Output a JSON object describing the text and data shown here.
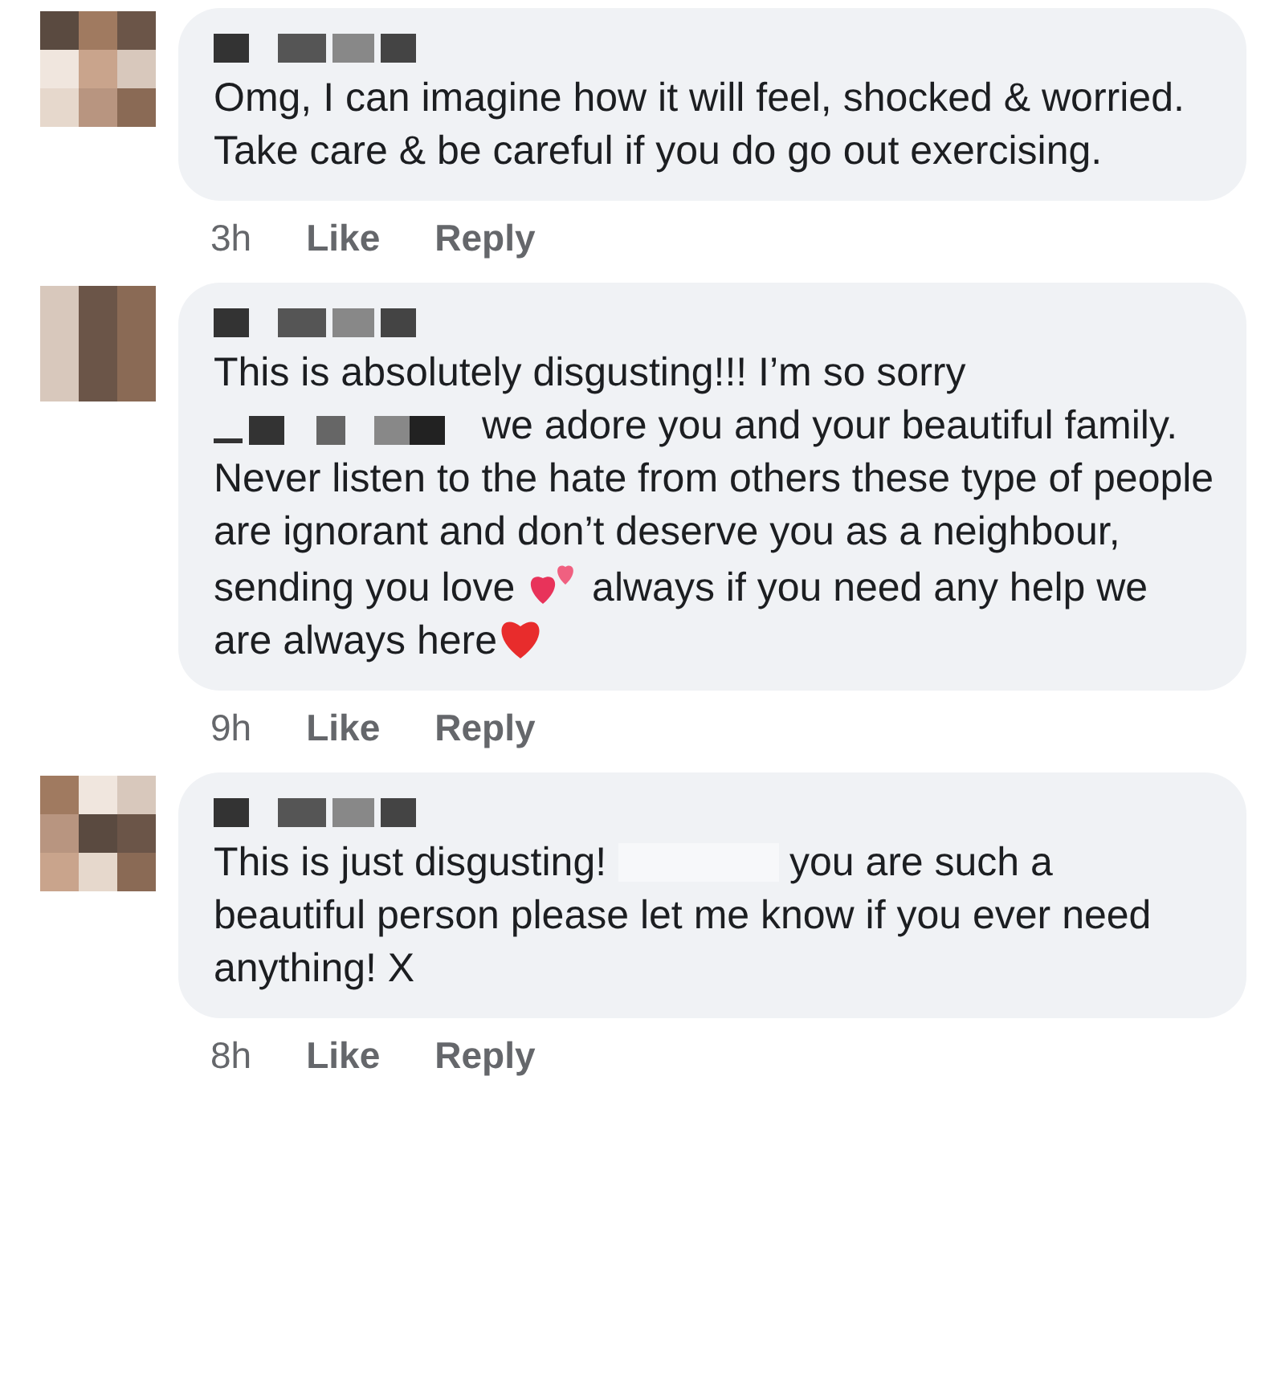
{
  "comments": [
    {
      "body": [
        {
          "kind": "text",
          "text": "Omg, I can imagine how it will feel, shocked & worried. Take care & be careful if you do go out exercising."
        }
      ],
      "time": "3h",
      "actions": [
        "Like",
        "Reply"
      ]
    },
    {
      "body": [
        {
          "kind": "text",
          "text": "This is absolutely disgusting!!! I’m so sorry "
        },
        {
          "kind": "redacted"
        },
        {
          "kind": "text",
          "text": " we adore you and your beautiful family. Never listen to the hate from others these type of people are ignorant and don’t deserve you as a neighbour, sending you love "
        },
        {
          "kind": "hearts"
        },
        {
          "kind": "text",
          "text": " always if you need any help we are always here"
        },
        {
          "kind": "heart"
        }
      ],
      "time": "9h",
      "actions": [
        "Like",
        "Reply"
      ]
    },
    {
      "body": [
        {
          "kind": "text",
          "text": "This is just disgusting! "
        },
        {
          "kind": "blank"
        },
        {
          "kind": "text",
          "text": " you are such a beautiful person please let me know if you ever need anything! X"
        }
      ],
      "time": "8h",
      "actions": [
        "Like",
        "Reply"
      ]
    }
  ]
}
